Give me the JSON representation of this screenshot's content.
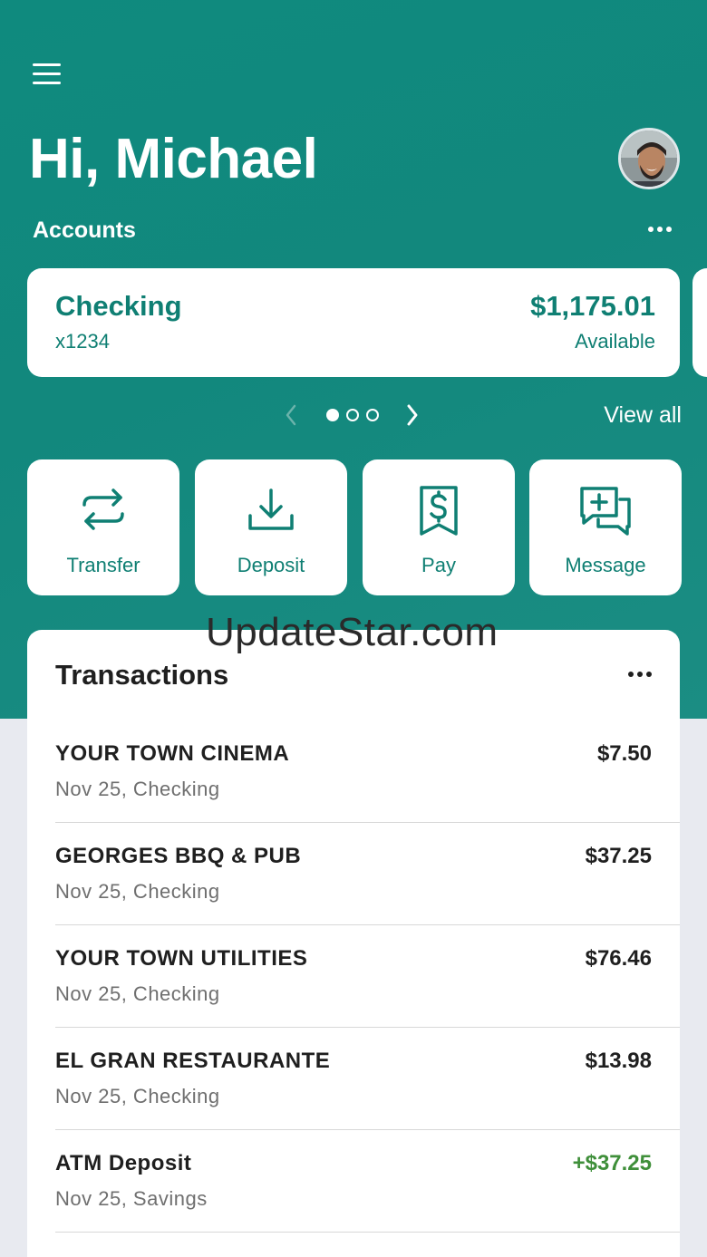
{
  "header": {
    "greeting": "Hi, Michael",
    "menu_icon": "hamburger-menu-icon",
    "avatar_icon": "user-avatar-photo"
  },
  "accounts": {
    "label": "Accounts",
    "more_icon": "more-horizontal-icon",
    "current": {
      "name": "Checking",
      "number": "x1234",
      "balance": "$1,175.01",
      "balance_label": "Available"
    },
    "pager": {
      "count": 3,
      "active_index": 0
    },
    "view_all": "View all"
  },
  "actions": [
    {
      "label": "Transfer",
      "icon": "transfer-arrows-icon"
    },
    {
      "label": "Deposit",
      "icon": "download-tray-icon"
    },
    {
      "label": "Pay",
      "icon": "receipt-dollar-icon"
    },
    {
      "label": "Message",
      "icon": "chat-plus-icon"
    }
  ],
  "transactions": {
    "title": "Transactions",
    "items": [
      {
        "merchant": "YOUR TOWN CINEMA",
        "meta": "Nov 25, Checking",
        "amount": "$7.50",
        "credit": false
      },
      {
        "merchant": "GEORGES BBQ & PUB",
        "meta": "Nov 25, Checking",
        "amount": "$37.25",
        "credit": false
      },
      {
        "merchant": "YOUR TOWN UTILITIES",
        "meta": "Nov 25, Checking",
        "amount": "$76.46",
        "credit": false
      },
      {
        "merchant": "EL GRAN RESTAURANTE",
        "meta": "Nov 25, Checking",
        "amount": "$13.98",
        "credit": false
      },
      {
        "merchant": "ATM Deposit",
        "meta": "Nov 25, Savings",
        "amount": "+$37.25",
        "credit": true
      }
    ]
  },
  "watermark": "UpdateStar.com",
  "colors": {
    "brand": "#12887d",
    "brand_text": "#0f7f73",
    "credit": "#3f8f3a",
    "page_bg": "#e8eaf0"
  }
}
